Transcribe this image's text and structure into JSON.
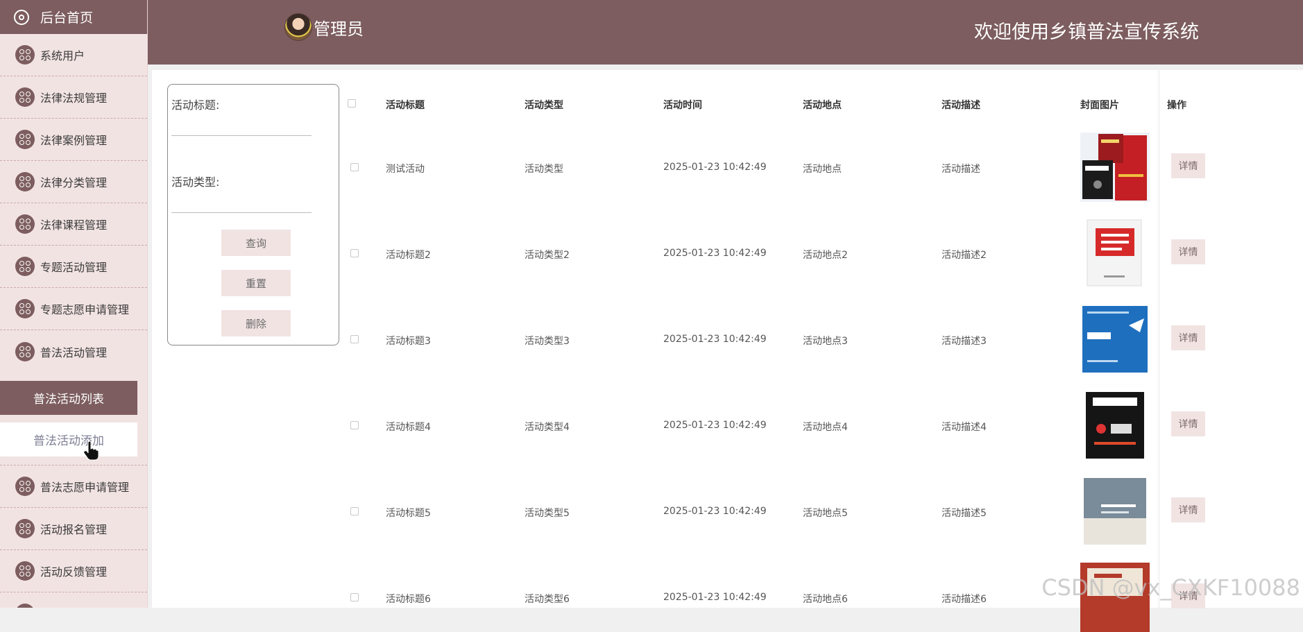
{
  "sidebar": {
    "home": "后台首页",
    "items": [
      {
        "label": "系统用户"
      },
      {
        "label": "法律法规管理"
      },
      {
        "label": "法律案例管理"
      },
      {
        "label": "法律分类管理"
      },
      {
        "label": "法律课程管理"
      },
      {
        "label": "专题活动管理"
      },
      {
        "label": "专题志愿申请管理"
      },
      {
        "label": "普法活动管理"
      }
    ],
    "submenu": {
      "active": "普法活动列表",
      "item": "普法活动添加"
    },
    "items_after": [
      {
        "label": "普法志愿申请管理"
      },
      {
        "label": "活动报名管理"
      },
      {
        "label": "活动反馈管理"
      }
    ]
  },
  "header": {
    "admin": "管理员",
    "title": "欢迎使用乡镇普法宣传系统"
  },
  "search": {
    "title_label": "活动标题:",
    "type_label": "活动类型:",
    "query_btn": "查询",
    "reset_btn": "重置",
    "delete_btn": "删除"
  },
  "table": {
    "columns": [
      "活动标题",
      "活动类型",
      "活动时间",
      "活动地点",
      "活动描述",
      "封面图片",
      "操作"
    ],
    "rows": [
      {
        "title": "测试活动",
        "type": "活动类型",
        "time": "2025-01-23 10:42:49",
        "place": "活动地点",
        "desc": "活动描述",
        "cover": "law-book-cover",
        "action": "详情"
      },
      {
        "title": "活动标题2",
        "type": "活动类型2",
        "time": "2025-01-23 10:42:49",
        "place": "活动地点2",
        "desc": "活动描述2",
        "cover": "civil-code-book-cover",
        "action": "详情"
      },
      {
        "title": "活动标题3",
        "type": "活动类型3",
        "time": "2025-01-23 10:42:49",
        "place": "活动地点3",
        "desc": "活动描述3",
        "cover": "international-law-book-cover",
        "action": "详情"
      },
      {
        "title": "活动标题4",
        "type": "活动类型4",
        "time": "2025-01-23 10:42:49",
        "place": "活动地点4",
        "desc": "活动描述4",
        "cover": "legal-knowledge-book-cover",
        "action": "详情"
      },
      {
        "title": "活动标题5",
        "type": "活动类型5",
        "time": "2025-01-23 10:42:49",
        "place": "活动地点5",
        "desc": "活动描述5",
        "cover": "grey-law-book-cover",
        "action": "详情"
      },
      {
        "title": "活动标题6",
        "type": "活动类型6",
        "time": "2025-01-23 10:42:49",
        "place": "活动地点6",
        "desc": "活动描述6",
        "cover": "red-law-book-cover",
        "action": "详情"
      }
    ]
  },
  "watermark": "CSDN @vx_CXKF10088",
  "colors": {
    "primary": "#7d5d5f",
    "sidebar_bg": "#f2e3e3",
    "button_bg": "#f2e3e3"
  }
}
